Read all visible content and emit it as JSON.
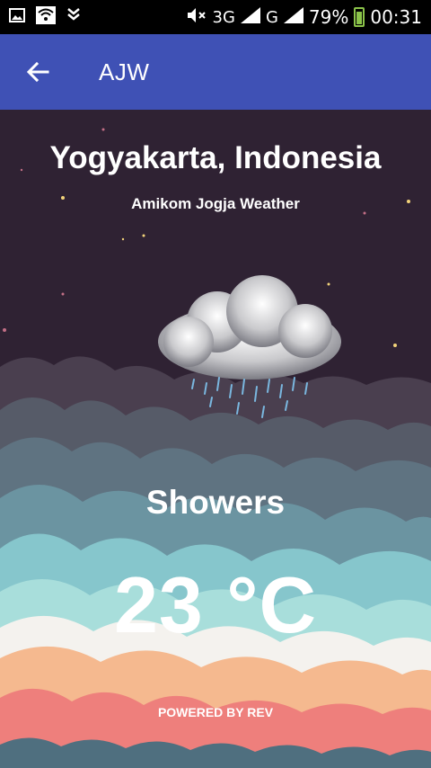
{
  "status_bar": {
    "network": "3G",
    "signal": "G",
    "battery": "79%",
    "time": "00:31"
  },
  "app_bar": {
    "title": "AJW",
    "back_icon": "arrow-back-icon"
  },
  "weather": {
    "location": "Yogyakarta, Indonesia",
    "subtitle": "Amikom Jogja Weather",
    "condition": "Showers",
    "temperature": "23 °C",
    "icon": "rain-cloud-icon",
    "powered_by": "POWERED BY REV"
  }
}
